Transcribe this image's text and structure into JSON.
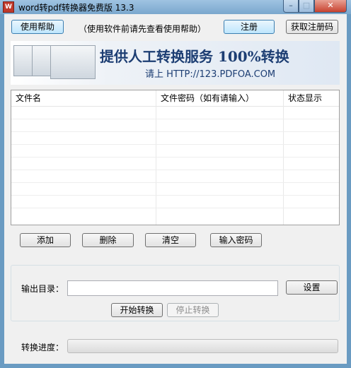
{
  "window": {
    "title": "word转pdf转换器免费版 13.3",
    "icon_label": "W",
    "min_glyph": "–",
    "max_glyph": "□",
    "close_glyph": "✕"
  },
  "top_bar": {
    "help_button": "使用帮助",
    "help_hint": "（使用软件前请先查看使用帮助）",
    "register_button": "注册",
    "get_code_button": "获取注册码"
  },
  "banner": {
    "headline": "提供人工转换服务 100%转换",
    "subline": "请上  HTTP://123.PDFOA.COM"
  },
  "file_list": {
    "columns": [
      "文件名",
      "文件密码（如有请输入）",
      "状态显示"
    ],
    "rows": []
  },
  "list_actions": {
    "add": "添加",
    "delete": "删除",
    "clear": "清空",
    "enter_password": "输入密码"
  },
  "output": {
    "dir_label": "输出目录：",
    "dir_value": "",
    "settings_button": "设置",
    "start_button": "开始转换",
    "stop_button": "停止转换"
  },
  "progress": {
    "label": "转换进度：",
    "value": 0
  }
}
